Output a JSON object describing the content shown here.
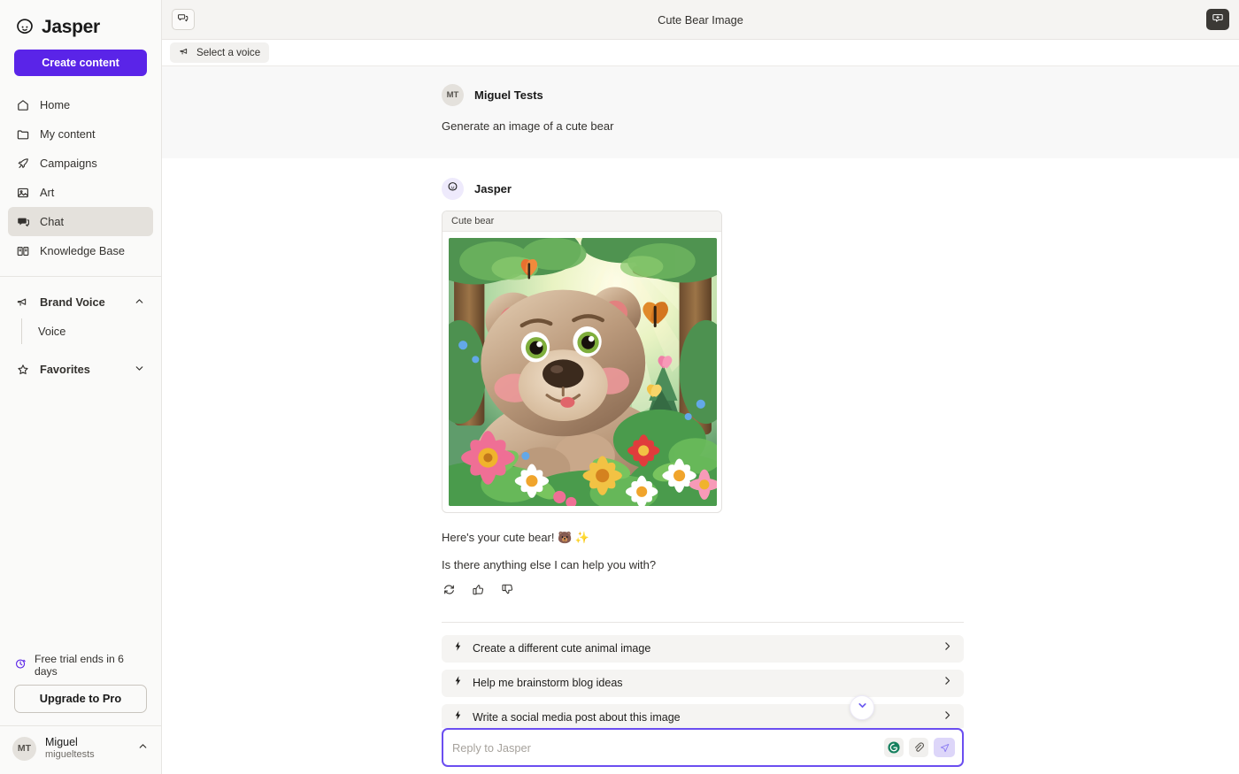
{
  "brand": {
    "name": "Jasper",
    "logo_icon": "jasper-blob-logo"
  },
  "sidebar": {
    "create_button": "Create content",
    "nav": [
      {
        "label": "Home",
        "icon": "home-icon",
        "active": false
      },
      {
        "label": "My content",
        "icon": "folder-icon",
        "active": false
      },
      {
        "label": "Campaigns",
        "icon": "rocket-icon",
        "active": false
      },
      {
        "label": "Art",
        "icon": "image-icon",
        "active": false
      },
      {
        "label": "Chat",
        "icon": "chat-icon",
        "active": true
      },
      {
        "label": "Knowledge Base",
        "icon": "book-icon",
        "active": false
      }
    ],
    "brand_voice": {
      "label": "Brand Voice",
      "icon": "megaphone-icon",
      "chevron": "chevron-up-icon",
      "children": [
        {
          "label": "Voice"
        }
      ]
    },
    "favorites": {
      "label": "Favorites",
      "icon": "star-icon",
      "chevron": "chevron-down-icon"
    },
    "trial": {
      "text": "Free trial ends in 6 days",
      "icon": "clock-icon",
      "icon_color": "#5a24e8"
    },
    "upgrade_button": "Upgrade to Pro",
    "user": {
      "initials": "MT",
      "name": "Miguel",
      "handle": "migueltests",
      "chevron": "chevron-up-icon"
    }
  },
  "topbar": {
    "left_button_icon": "chat-panel-icon",
    "title": "Cute Bear Image",
    "right_button_icon": "new-chat-icon"
  },
  "voicebar": {
    "label": "Select a voice",
    "icon": "megaphone-icon"
  },
  "conversation": {
    "user_message": {
      "initials": "MT",
      "author": "Miguel Tests",
      "text": "Generate an image of a cute bear"
    },
    "ai_message": {
      "author": "Jasper",
      "avatar_icon": "jasper-blob-logo",
      "image_card_label": "Cute bear",
      "image_alt": "Cute cartoon bear in a sunlit forest with butterflies and flowers",
      "line_1": "Here's your cute bear! 🐻 ✨",
      "line_2": "Is there anything else I can help you with?",
      "actions": [
        {
          "name": "regenerate-icon"
        },
        {
          "name": "thumbs-up-icon"
        },
        {
          "name": "thumbs-down-icon"
        }
      ]
    }
  },
  "suggestions": [
    {
      "label": "Create a different cute animal image",
      "icon": "lightning-icon",
      "chevron": "chevron-right-icon"
    },
    {
      "label": "Help me brainstorm blog ideas",
      "icon": "lightning-icon",
      "chevron": "chevron-right-icon"
    },
    {
      "label": "Write a social media post about this image",
      "icon": "lightning-icon",
      "chevron": "chevron-right-icon"
    }
  ],
  "scroll_down_button": {
    "icon": "chevron-down-icon",
    "color": "#6b5bf0"
  },
  "composer": {
    "placeholder": "Reply to Jasper",
    "value": "",
    "grammarly_icon": "grammarly-icon",
    "attach_icon": "paperclip-icon",
    "send_icon": "send-icon",
    "focus_color": "#6b4ef0"
  }
}
